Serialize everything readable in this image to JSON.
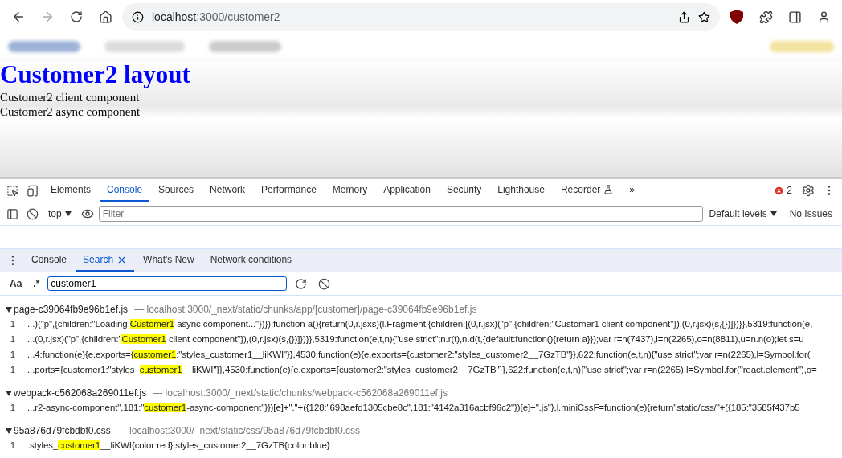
{
  "browser": {
    "url_host": "localhost",
    "url_path": ":3000/customer2"
  },
  "page": {
    "heading": "Customer2 layout",
    "lines": [
      "Customer2 client component",
      "Customer2 async component"
    ]
  },
  "devtools": {
    "tabs": [
      {
        "label": "Elements",
        "selected": false
      },
      {
        "label": "Console",
        "selected": true
      },
      {
        "label": "Sources",
        "selected": false
      },
      {
        "label": "Network",
        "selected": false
      },
      {
        "label": "Performance",
        "selected": false
      },
      {
        "label": "Memory",
        "selected": false
      },
      {
        "label": "Application",
        "selected": false
      },
      {
        "label": "Security",
        "selected": false
      },
      {
        "label": "Lighthouse",
        "selected": false
      },
      {
        "label": "Recorder",
        "selected": false
      }
    ],
    "more_tabs": "»",
    "error_count": "2",
    "console_toolbar": {
      "context": "top",
      "filter_placeholder": "Filter",
      "levels": "Default levels",
      "issues": "No Issues"
    },
    "drawer_tabs": [
      {
        "label": "Console",
        "selected": false,
        "closable": false
      },
      {
        "label": "Search",
        "selected": true,
        "closable": true
      },
      {
        "label": "What's New",
        "selected": false,
        "closable": false
      },
      {
        "label": "Network conditions",
        "selected": false,
        "closable": false
      }
    ],
    "search": {
      "case_toggle": "Aa",
      "regex_toggle": ".*",
      "value": "customer1"
    },
    "results": [
      {
        "file": "page-c39064fb9e96b1ef.js",
        "path": "— localhost:3000/_next/static/chunks/app/[customer]/page-c39064fb9e96b1ef.js",
        "expanded": true,
        "matches": [
          {
            "line": "1",
            "before": "...)(\"p\",{children:\"Loading ",
            "match": "Customer1",
            "after": " async component...\"})});function a(){return(0,r.jsxs)(l.Fragment,{children:[(0,r.jsx)(\"p\",{children:\"Customer1 client component\"}),(0,r.jsx)(s,{})]})}},5319:function(e,"
          },
          {
            "line": "1",
            "before": "...(0,r.jsx)(\"p\",{children:\"",
            "match": "Customer1",
            "after": " client component\"}),(0,r.jsx)(s,{})]})}},5319:function(e,t,n){\"use strict\";n.r(t),n.d(t,{default:function(){return a}});var r=n(7437),l=n(2265),o=n(8811),u=n.n(o);let s=u"
          },
          {
            "line": "1",
            "before": "...4:function(e){e.exports={",
            "match": "customer1",
            "after": ":\"styles_customer1__liKWI\"}},4530:function(e){e.exports={customer2:\"styles_customer2__7GzTB\"}},622:function(e,t,n){\"use strict\";var r=n(2265),l=Symbol.for("
          },
          {
            "line": "1",
            "before": "...ports={customer1:\"styles_",
            "match": "customer1",
            "after": "__liKWI\"}},4530:function(e){e.exports={customer2:\"styles_customer2__7GzTB\"}},622:function(e,t,n){\"use strict\";var r=n(2265),l=Symbol.for(\"react.element\"),o="
          }
        ]
      },
      {
        "file": "webpack-c562068a269011ef.js",
        "path": "— localhost:3000/_next/static/chunks/webpack-c562068a269011ef.js",
        "expanded": true,
        "matches": [
          {
            "line": "1",
            "before": "...r2-async-component\",181:\"",
            "match": "customer1",
            "after": "-async-component\"}})[e]+\".\"+({128:\"698aefd1305cbe8c\",181:\"4142a316acbf96c2\"})[e]+\".js\"},l.miniCssF=function(e){return\"static/css/\"+({185:\"3585f437b5"
          }
        ]
      },
      {
        "file": "95a876d79fcbdbf0.css",
        "path": "— localhost:3000/_next/static/css/95a876d79fcbdbf0.css",
        "expanded": true,
        "matches": [
          {
            "line": "1",
            "before": ".styles_",
            "match": "customer1",
            "after": "__liKWI{color:red}.styles_customer2__7GzTB{color:blue}"
          }
        ]
      }
    ]
  }
}
